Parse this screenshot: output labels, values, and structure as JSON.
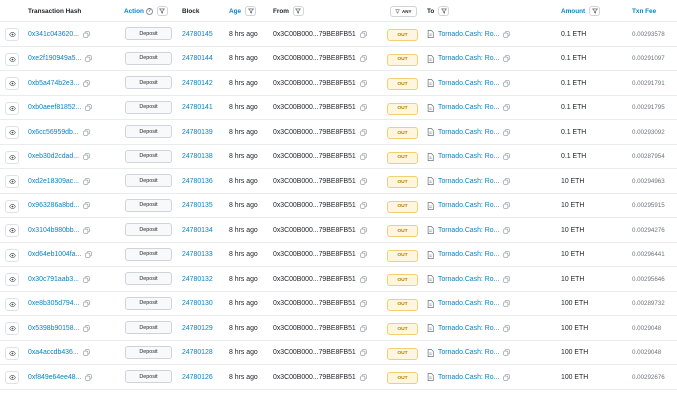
{
  "header": {
    "txn_hash": "Transaction Hash",
    "action": "Action",
    "action_help": "?",
    "block": "Block",
    "age": "Age",
    "from": "From",
    "direction_filter": "ANY",
    "to": "To",
    "amount": "Amount",
    "fee": "Txn Fee"
  },
  "icons": {
    "eye": "eye-icon",
    "copy": "copy-icon",
    "filter": "filter-icon",
    "contract": "document-icon",
    "help": "question-circle-icon"
  },
  "colors": {
    "link": "#0784c3",
    "out_badge_bg": "#fff6dd",
    "out_badge_border": "#f2cf72",
    "out_badge_text": "#b47d00"
  },
  "rows": [
    {
      "hash": "0x341c043620...",
      "method": "Deposit",
      "block": "24780145",
      "age": "8 hrs ago",
      "from": "0x3C00B000...79BE8FB51",
      "dir": "OUT",
      "to": "Tornado.Cash: Ro...",
      "amount": "0.1 ETH",
      "fee": "0.00293578"
    },
    {
      "hash": "0xe2f190949a5...",
      "method": "Deposit",
      "block": "24780144",
      "age": "8 hrs ago",
      "from": "0x3C00B000...79BE8FB51",
      "dir": "OUT",
      "to": "Tornado.Cash: Ro...",
      "amount": "0.1 ETH",
      "fee": "0.00291097"
    },
    {
      "hash": "0xb5a474b2e3...",
      "method": "Deposit",
      "block": "24780142",
      "age": "8 hrs ago",
      "from": "0x3C00B000...79BE8FB51",
      "dir": "OUT",
      "to": "Tornado.Cash: Ro...",
      "amount": "0.1 ETH",
      "fee": "0.00291791"
    },
    {
      "hash": "0xb0aeef81852...",
      "method": "Deposit",
      "block": "24780141",
      "age": "8 hrs ago",
      "from": "0x3C00B000...79BE8FB51",
      "dir": "OUT",
      "to": "Tornado.Cash: Ro...",
      "amount": "0.1 ETH",
      "fee": "0.00291795"
    },
    {
      "hash": "0x6cc56959db...",
      "method": "Deposit",
      "block": "24780139",
      "age": "8 hrs ago",
      "from": "0x3C00B000...79BE8FB51",
      "dir": "OUT",
      "to": "Tornado.Cash: Ro...",
      "amount": "0.1 ETH",
      "fee": "0.00293092"
    },
    {
      "hash": "0xeb30d2cdad...",
      "method": "Deposit",
      "block": "24780138",
      "age": "8 hrs ago",
      "from": "0x3C00B000...79BE8FB51",
      "dir": "OUT",
      "to": "Tornado.Cash: Ro...",
      "amount": "0.1 ETH",
      "fee": "0.00287954"
    },
    {
      "hash": "0xd2e18309ac...",
      "method": "Deposit",
      "block": "24780136",
      "age": "8 hrs ago",
      "from": "0x3C00B000...79BE8FB51",
      "dir": "OUT",
      "to": "Tornado.Cash: Ro...",
      "amount": "10 ETH",
      "fee": "0.00294963"
    },
    {
      "hash": "0x963286a8bd...",
      "method": "Deposit",
      "block": "24780135",
      "age": "8 hrs ago",
      "from": "0x3C00B000...79BE8FB51",
      "dir": "OUT",
      "to": "Tornado.Cash: Ro...",
      "amount": "10 ETH",
      "fee": "0.00295915"
    },
    {
      "hash": "0x3104b980bb...",
      "method": "Deposit",
      "block": "24780134",
      "age": "8 hrs ago",
      "from": "0x3C00B000...79BE8FB51",
      "dir": "OUT",
      "to": "Tornado.Cash: Ro...",
      "amount": "10 ETH",
      "fee": "0.00294276"
    },
    {
      "hash": "0xd64eb1004fa...",
      "method": "Deposit",
      "block": "24780133",
      "age": "8 hrs ago",
      "from": "0x3C00B000...79BE8FB51",
      "dir": "OUT",
      "to": "Tornado.Cash: Ro...",
      "amount": "10 ETH",
      "fee": "0.00296441"
    },
    {
      "hash": "0x30c791aab3...",
      "method": "Deposit",
      "block": "24780132",
      "age": "8 hrs ago",
      "from": "0x3C00B000...79BE8FB51",
      "dir": "OUT",
      "to": "Tornado.Cash: Ro...",
      "amount": "10 ETH",
      "fee": "0.00295646"
    },
    {
      "hash": "0xe8b305d794...",
      "method": "Deposit",
      "block": "24780130",
      "age": "8 hrs ago",
      "from": "0x3C00B000...79BE8FB51",
      "dir": "OUT",
      "to": "Tornado.Cash: Ro...",
      "amount": "100 ETH",
      "fee": "0.00289732"
    },
    {
      "hash": "0x5398b90158...",
      "method": "Deposit",
      "block": "24780129",
      "age": "8 hrs ago",
      "from": "0x3C00B000...79BE8FB51",
      "dir": "OUT",
      "to": "Tornado.Cash: Ro...",
      "amount": "100 ETH",
      "fee": "0.0029048"
    },
    {
      "hash": "0xa4accdb436...",
      "method": "Deposit",
      "block": "24780128",
      "age": "8 hrs ago",
      "from": "0x3C00B000...79BE8FB51",
      "dir": "OUT",
      "to": "Tornado.Cash: Ro...",
      "amount": "100 ETH",
      "fee": "0.0029048"
    },
    {
      "hash": "0xf849e64ee48...",
      "method": "Deposit",
      "block": "24780126",
      "age": "8 hrs ago",
      "from": "0x3C00B000...79BE8FB51",
      "dir": "OUT",
      "to": "Tornado.Cash: Ro...",
      "amount": "100 ETH",
      "fee": "0.00292676"
    }
  ]
}
